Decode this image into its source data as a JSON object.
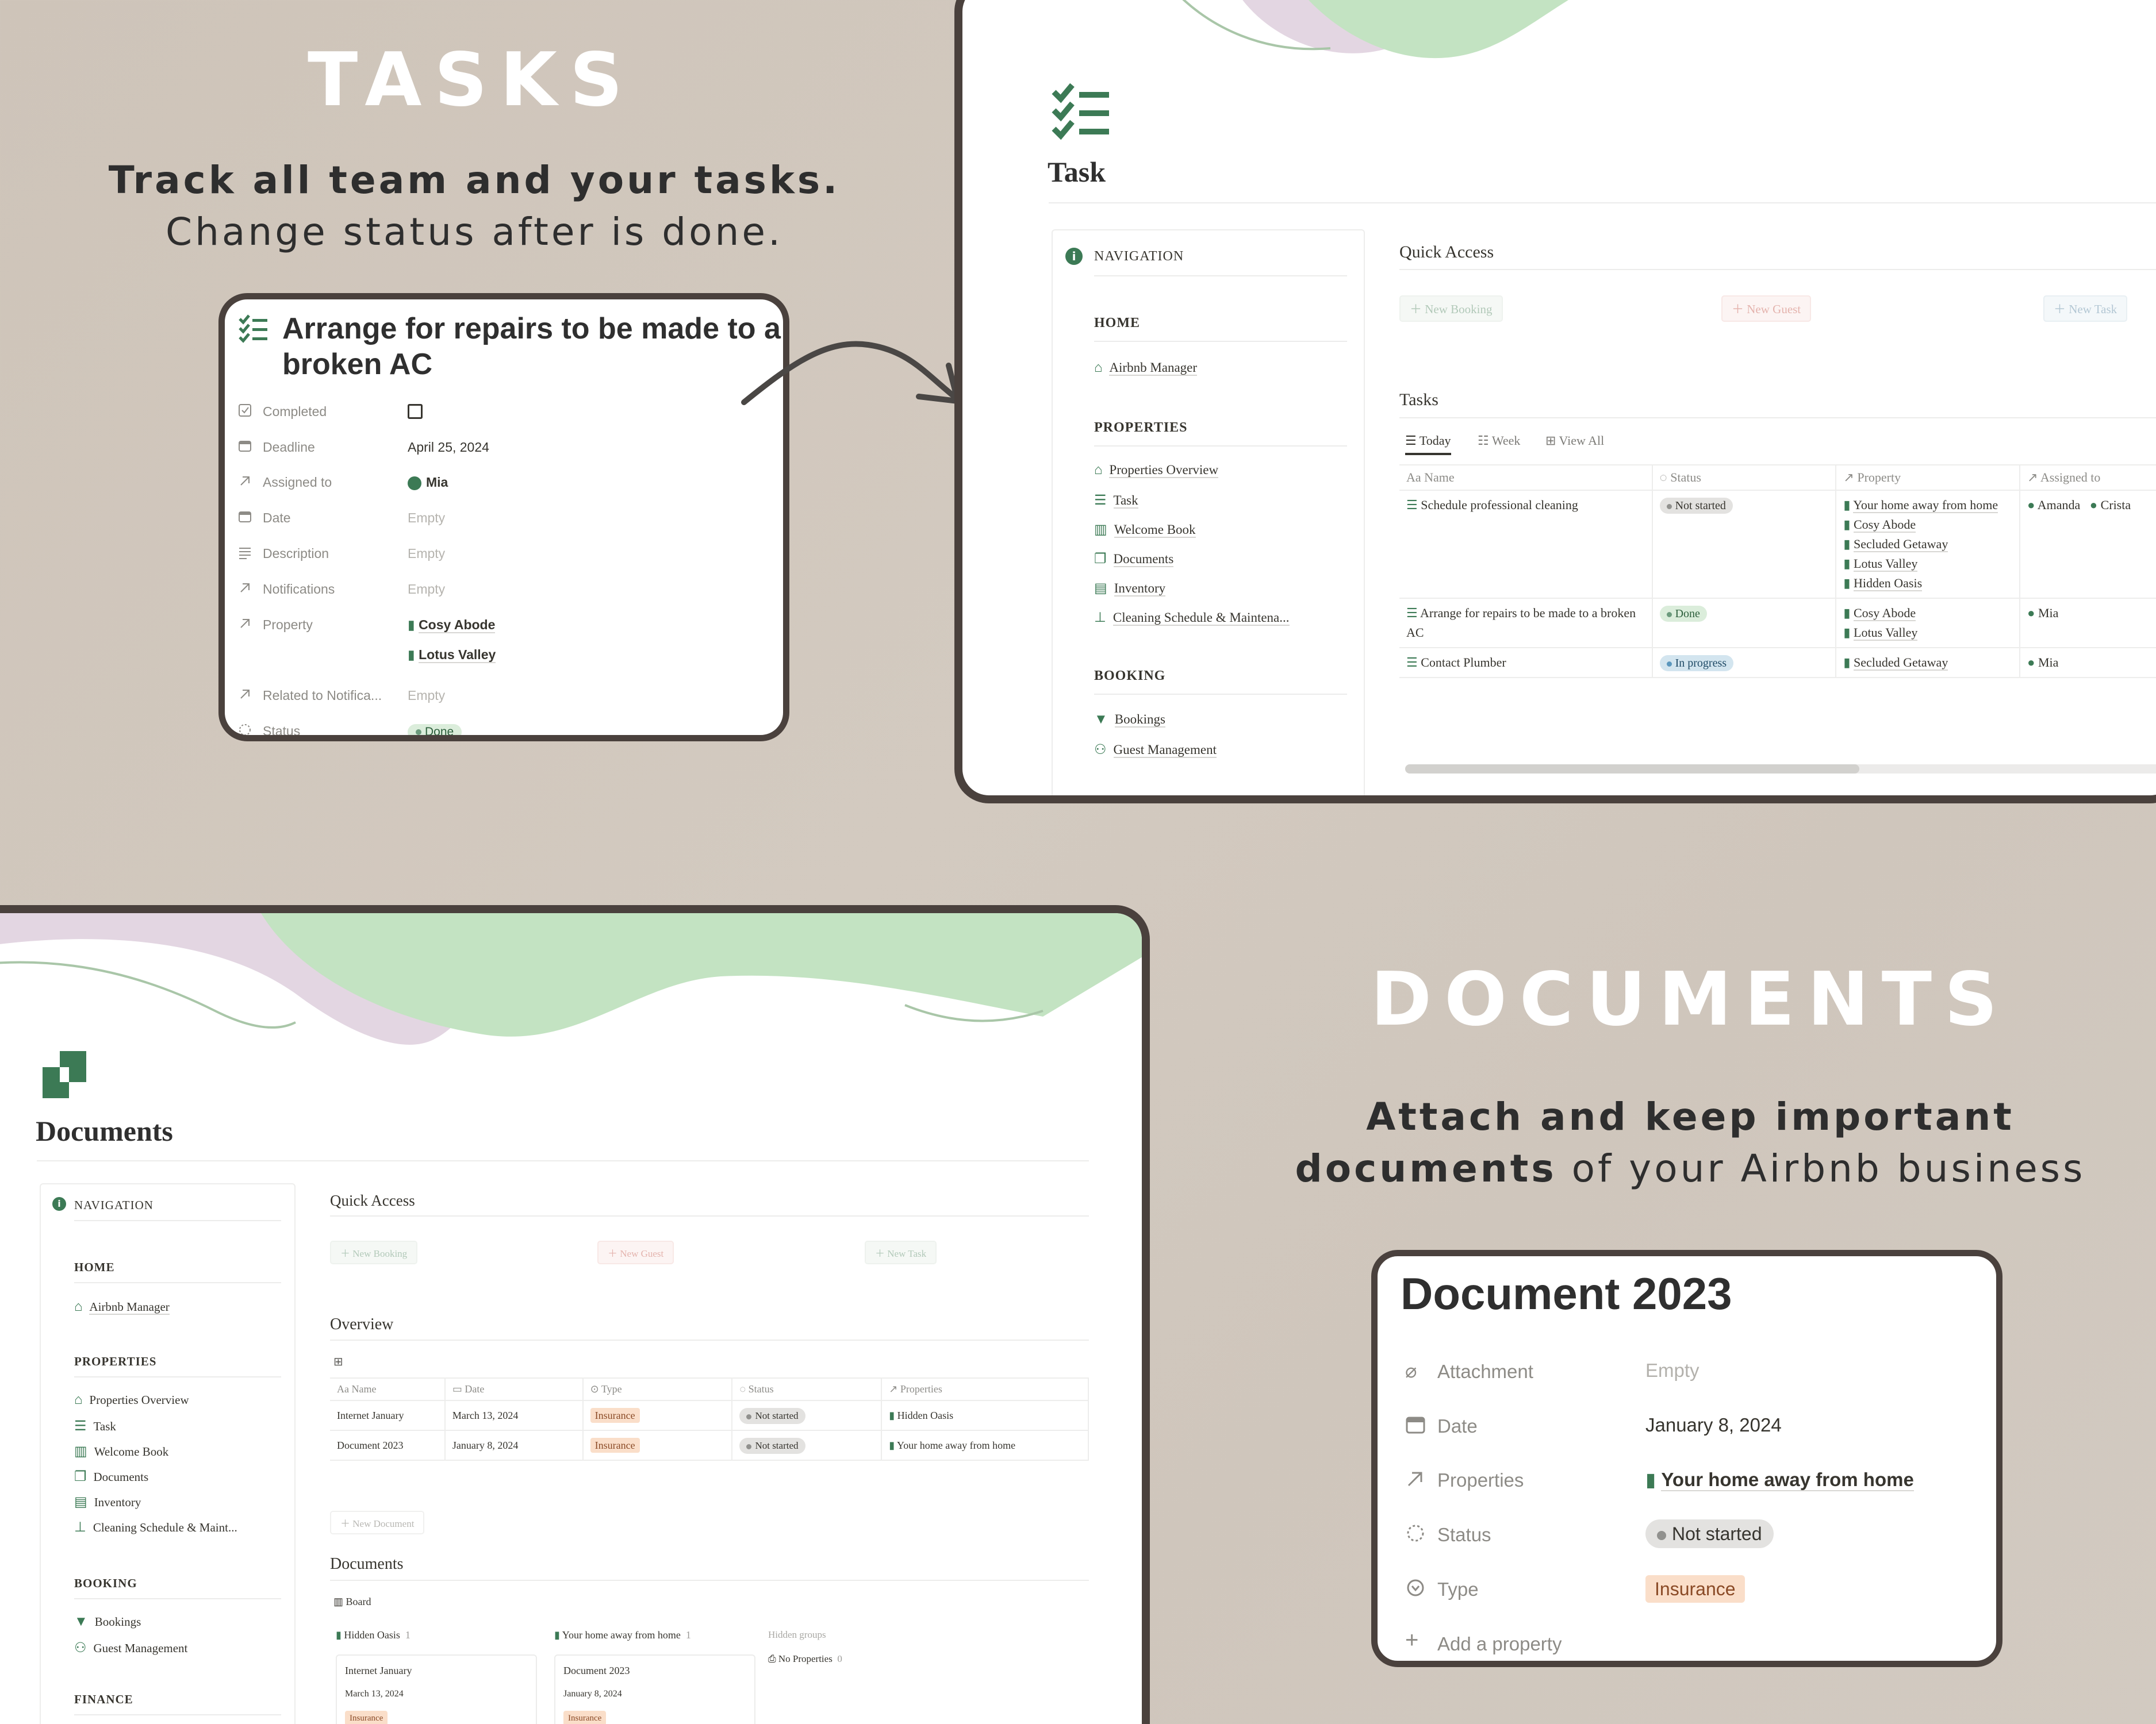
{
  "hero_tasks": {
    "heading": "TASKS",
    "line1": "Track all team and your tasks.",
    "line2": "Change status after is done."
  },
  "hero_documents": {
    "heading": "DOCUMENTS",
    "line1_bold": "Attach and keep important",
    "line2_bold": "documents",
    "line2_rest": " of your Airbnb business"
  },
  "task_card": {
    "title": "Arrange for repairs to be made to a broken AC",
    "props": [
      {
        "key": "Completed",
        "icon": "checkbox-icon",
        "value": ""
      },
      {
        "key": "Deadline",
        "icon": "calendar-icon",
        "value": "April 25, 2024"
      },
      {
        "key": "Assigned to",
        "icon": "arrow-up-right-icon",
        "value": "Mia"
      },
      {
        "key": "Date",
        "icon": "calendar-icon",
        "value": "Empty"
      },
      {
        "key": "Description",
        "icon": "lines-icon",
        "value": "Empty"
      },
      {
        "key": "Notifications",
        "icon": "arrow-up-right-icon",
        "value": "Empty"
      },
      {
        "key": "Property",
        "icon": "arrow-up-right-icon",
        "value": "Cosy Abode",
        "value2": "Lotus Valley"
      },
      {
        "key": "Related to Notifica...",
        "icon": "arrow-up-right-icon",
        "value": "Empty"
      },
      {
        "key": "Status",
        "icon": "status-icon",
        "value": "Done"
      }
    ]
  },
  "task_page": {
    "title": "Task",
    "nav": {
      "header": "NAVIGATION",
      "home_label": "HOME",
      "home_items": [
        "Airbnb Manager"
      ],
      "properties_label": "PROPERTIES",
      "properties_items": [
        "Properties Overview",
        "Task",
        "Welcome Book",
        "Documents",
        "Inventory",
        "Cleaning Schedule & Maintena..."
      ],
      "booking_label": "BOOKING",
      "booking_items": [
        "Bookings",
        "Guest Management"
      ]
    },
    "quick_access": {
      "title": "Quick Access",
      "new_booking": "New Booking",
      "new_guest": "New Guest",
      "new_task": "New Task"
    },
    "tasks_title": "Tasks",
    "tabs": [
      "Today",
      "Week",
      "View All"
    ],
    "columns": [
      "Name",
      "Status",
      "Property",
      "Assigned to"
    ],
    "rows": [
      {
        "name": "Schedule professional cleaning",
        "status": "Not started",
        "properties": [
          "Your home away from home",
          "Cosy Abode",
          "Secluded Getaway",
          "Lotus Valley",
          "Hidden Oasis"
        ],
        "assigned": [
          "Amanda",
          "Crista"
        ]
      },
      {
        "name": "Arrange for repairs to be made to a broken AC",
        "status": "Done",
        "properties": [
          "Cosy Abode",
          "Lotus Valley"
        ],
        "assigned": [
          "Mia"
        ]
      },
      {
        "name": "Contact Plumber",
        "status": "In progress",
        "properties": [
          "Secluded Getaway"
        ],
        "assigned": [
          "Mia"
        ]
      }
    ]
  },
  "doc_page": {
    "title": "Documents",
    "nav": {
      "header": "NAVIGATION",
      "home_label": "HOME",
      "home_items": [
        "Airbnb Manager"
      ],
      "properties_label": "PROPERTIES",
      "properties_items": [
        "Properties Overview",
        "Task",
        "Welcome Book",
        "Documents",
        "Inventory",
        "Cleaning Schedule & Maint..."
      ],
      "booking_label": "BOOKING",
      "booking_items": [
        "Bookings",
        "Guest Management"
      ],
      "finance_label": "FINANCE"
    },
    "quick_access": {
      "title": "Quick Access",
      "new_booking": "New Booking",
      "new_guest": "New Guest",
      "new_task": "New Task"
    },
    "overview_title": "Overview",
    "columns": [
      "Name",
      "Date",
      "Type",
      "Status",
      "Properties"
    ],
    "rows": [
      {
        "name": "Internet January",
        "date": "March 13, 2024",
        "type": "Insurance",
        "status": "Not started",
        "property": "Hidden Oasis"
      },
      {
        "name": "Document 2023",
        "date": "January 8, 2024",
        "type": "Insurance",
        "status": "Not started",
        "property": "Your home away from home"
      }
    ],
    "new_document": "New Document",
    "documents_title": "Documents",
    "board_tab": "Board",
    "board": {
      "col1": {
        "name": "Hidden Oasis",
        "count": "1",
        "card_title": "Internet January",
        "card_date": "March 13, 2024",
        "card_tag": "Insurance"
      },
      "col2": {
        "name": "Your home away from home",
        "count": "1",
        "card_title": "Document 2023",
        "card_date": "January 8, 2024",
        "card_tag": "Insurance"
      },
      "hidden_groups": "Hidden groups",
      "no_properties": "No Properties",
      "no_properties_count": "0"
    }
  },
  "doc_card": {
    "title": "Document 2023",
    "props": [
      {
        "key": "Attachment",
        "value": "Empty"
      },
      {
        "key": "Date",
        "value": "January 8, 2024"
      },
      {
        "key": "Properties",
        "value": "Your home away from home"
      },
      {
        "key": "Status",
        "value": "Not started"
      },
      {
        "key": "Type",
        "value": "Insurance"
      }
    ],
    "add_property": "Add a property"
  },
  "colors": {
    "frame": "#4a413d",
    "accent_green": "#3c7a55",
    "wave_green": "#c3e3c2",
    "wave_lilac": "#e3d6e2",
    "background": "#cec4b9"
  }
}
